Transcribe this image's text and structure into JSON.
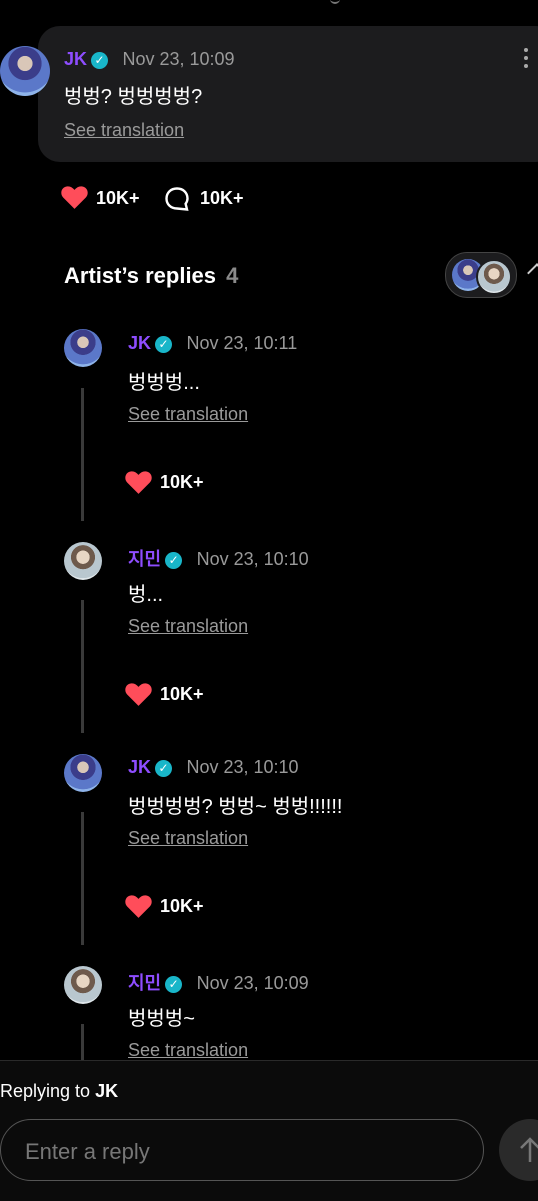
{
  "post": {
    "author": "JK",
    "time": "Nov 23, 10:09",
    "text": "벙벙? 벙벙벙벙?",
    "see_translation": "See translation",
    "likes": "10K+",
    "comments": "10K+"
  },
  "replies_header": {
    "title": "Artist’s replies",
    "count": "4"
  },
  "replies": [
    {
      "author": "JK",
      "time": "Nov 23, 10:11",
      "text": "벙벙벙...",
      "see_translation": "See translation",
      "likes": "10K+"
    },
    {
      "author": "지민",
      "time": "Nov 23, 10:10",
      "text": "벙...",
      "see_translation": "See translation",
      "likes": "10K+"
    },
    {
      "author": "JK",
      "time": "Nov 23, 10:10",
      "text": "벙벙벙벙? 벙벙~ 벙벙!!!!!!",
      "see_translation": "See translation",
      "likes": "10K+"
    },
    {
      "author": "지민",
      "time": "Nov 23, 10:09",
      "text": "벙벙벙~",
      "see_translation": "See translation"
    }
  ],
  "composer": {
    "replying_prefix": "Replying to",
    "replying_to": "JK",
    "placeholder": "Enter a reply"
  },
  "colors": {
    "accent_name": "#8e4dff",
    "verified": "#19b6c9",
    "heart": "#ff4d5a"
  }
}
